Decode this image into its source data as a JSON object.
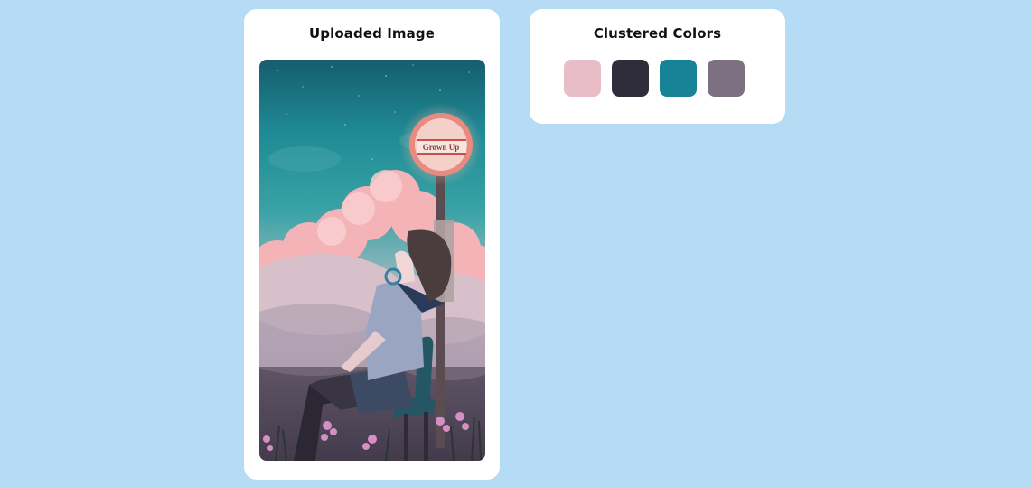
{
  "uploaded_panel": {
    "title": "Uploaded Image",
    "image": {
      "sign_text": "Grown Up"
    }
  },
  "colors_panel": {
    "title": "Clustered Colors",
    "swatches": [
      {
        "color": "#e8bdc7"
      },
      {
        "color": "#2f2d3a"
      },
      {
        "color": "#178396"
      },
      {
        "color": "#7d7080"
      }
    ]
  }
}
